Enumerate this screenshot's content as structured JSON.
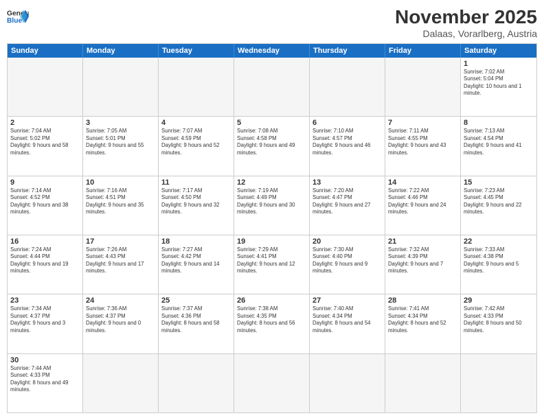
{
  "logo": {
    "text_general": "General",
    "text_blue": "Blue"
  },
  "title": {
    "month_year": "November 2025",
    "location": "Dalaas, Vorarlberg, Austria"
  },
  "header_days": [
    "Sunday",
    "Monday",
    "Tuesday",
    "Wednesday",
    "Thursday",
    "Friday",
    "Saturday"
  ],
  "weeks": [
    [
      {
        "day": "",
        "empty": true
      },
      {
        "day": "",
        "empty": true
      },
      {
        "day": "",
        "empty": true
      },
      {
        "day": "",
        "empty": true
      },
      {
        "day": "",
        "empty": true
      },
      {
        "day": "",
        "empty": true
      },
      {
        "day": "1",
        "info": "Sunrise: 7:02 AM\nSunset: 5:04 PM\nDaylight: 10 hours and 1 minute."
      }
    ],
    [
      {
        "day": "2",
        "info": "Sunrise: 7:04 AM\nSunset: 5:02 PM\nDaylight: 9 hours and 58 minutes."
      },
      {
        "day": "3",
        "info": "Sunrise: 7:05 AM\nSunset: 5:01 PM\nDaylight: 9 hours and 55 minutes."
      },
      {
        "day": "4",
        "info": "Sunrise: 7:07 AM\nSunset: 4:59 PM\nDaylight: 9 hours and 52 minutes."
      },
      {
        "day": "5",
        "info": "Sunrise: 7:08 AM\nSunset: 4:58 PM\nDaylight: 9 hours and 49 minutes."
      },
      {
        "day": "6",
        "info": "Sunrise: 7:10 AM\nSunset: 4:57 PM\nDaylight: 9 hours and 46 minutes."
      },
      {
        "day": "7",
        "info": "Sunrise: 7:11 AM\nSunset: 4:55 PM\nDaylight: 9 hours and 43 minutes."
      },
      {
        "day": "8",
        "info": "Sunrise: 7:13 AM\nSunset: 4:54 PM\nDaylight: 9 hours and 41 minutes."
      }
    ],
    [
      {
        "day": "9",
        "info": "Sunrise: 7:14 AM\nSunset: 4:52 PM\nDaylight: 9 hours and 38 minutes."
      },
      {
        "day": "10",
        "info": "Sunrise: 7:16 AM\nSunset: 4:51 PM\nDaylight: 9 hours and 35 minutes."
      },
      {
        "day": "11",
        "info": "Sunrise: 7:17 AM\nSunset: 4:50 PM\nDaylight: 9 hours and 32 minutes."
      },
      {
        "day": "12",
        "info": "Sunrise: 7:19 AM\nSunset: 4:49 PM\nDaylight: 9 hours and 30 minutes."
      },
      {
        "day": "13",
        "info": "Sunrise: 7:20 AM\nSunset: 4:47 PM\nDaylight: 9 hours and 27 minutes."
      },
      {
        "day": "14",
        "info": "Sunrise: 7:22 AM\nSunset: 4:46 PM\nDaylight: 9 hours and 24 minutes."
      },
      {
        "day": "15",
        "info": "Sunrise: 7:23 AM\nSunset: 4:45 PM\nDaylight: 9 hours and 22 minutes."
      }
    ],
    [
      {
        "day": "16",
        "info": "Sunrise: 7:24 AM\nSunset: 4:44 PM\nDaylight: 9 hours and 19 minutes."
      },
      {
        "day": "17",
        "info": "Sunrise: 7:26 AM\nSunset: 4:43 PM\nDaylight: 9 hours and 17 minutes."
      },
      {
        "day": "18",
        "info": "Sunrise: 7:27 AM\nSunset: 4:42 PM\nDaylight: 9 hours and 14 minutes."
      },
      {
        "day": "19",
        "info": "Sunrise: 7:29 AM\nSunset: 4:41 PM\nDaylight: 9 hours and 12 minutes."
      },
      {
        "day": "20",
        "info": "Sunrise: 7:30 AM\nSunset: 4:40 PM\nDaylight: 9 hours and 9 minutes."
      },
      {
        "day": "21",
        "info": "Sunrise: 7:32 AM\nSunset: 4:39 PM\nDaylight: 9 hours and 7 minutes."
      },
      {
        "day": "22",
        "info": "Sunrise: 7:33 AM\nSunset: 4:38 PM\nDaylight: 9 hours and 5 minutes."
      }
    ],
    [
      {
        "day": "23",
        "info": "Sunrise: 7:34 AM\nSunset: 4:37 PM\nDaylight: 9 hours and 3 minutes."
      },
      {
        "day": "24",
        "info": "Sunrise: 7:36 AM\nSunset: 4:37 PM\nDaylight: 9 hours and 0 minutes."
      },
      {
        "day": "25",
        "info": "Sunrise: 7:37 AM\nSunset: 4:36 PM\nDaylight: 8 hours and 58 minutes."
      },
      {
        "day": "26",
        "info": "Sunrise: 7:38 AM\nSunset: 4:35 PM\nDaylight: 8 hours and 56 minutes."
      },
      {
        "day": "27",
        "info": "Sunrise: 7:40 AM\nSunset: 4:34 PM\nDaylight: 8 hours and 54 minutes."
      },
      {
        "day": "28",
        "info": "Sunrise: 7:41 AM\nSunset: 4:34 PM\nDaylight: 8 hours and 52 minutes."
      },
      {
        "day": "29",
        "info": "Sunrise: 7:42 AM\nSunset: 4:33 PM\nDaylight: 8 hours and 50 minutes."
      }
    ],
    [
      {
        "day": "30",
        "info": "Sunrise: 7:44 AM\nSunset: 4:33 PM\nDaylight: 8 hours and 49 minutes."
      },
      {
        "day": "",
        "empty": true
      },
      {
        "day": "",
        "empty": true
      },
      {
        "day": "",
        "empty": true
      },
      {
        "day": "",
        "empty": true
      },
      {
        "day": "",
        "empty": true
      },
      {
        "day": "",
        "empty": true
      }
    ]
  ]
}
